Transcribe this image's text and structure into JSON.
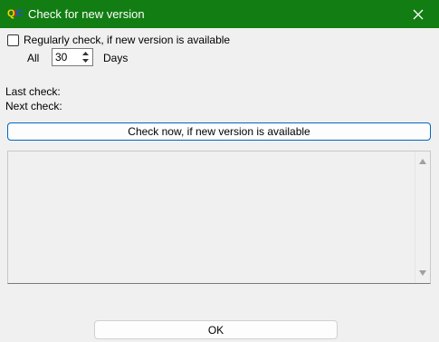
{
  "window": {
    "title": "Check for new version",
    "app_icon_letters": [
      "Q",
      "I",
      "C"
    ],
    "app_icon_colors": [
      "#ffd400",
      "#e0201e",
      "#2050e0"
    ],
    "close_icon": "close-icon"
  },
  "auto_check": {
    "checked": false,
    "label": "Regularly check, if new version is available",
    "prefix": "All",
    "interval_value": "30",
    "suffix": "Days"
  },
  "status": {
    "last_check_label": "Last check:",
    "next_check_label": "Next check:"
  },
  "check_now_button": "Check now, if new version is available",
  "output_memo": {
    "text": ""
  },
  "ok_button": "OK",
  "colors": {
    "titlebar": "#127d12",
    "accent": "#0067c0",
    "window_bg": "#f0f0f0"
  }
}
